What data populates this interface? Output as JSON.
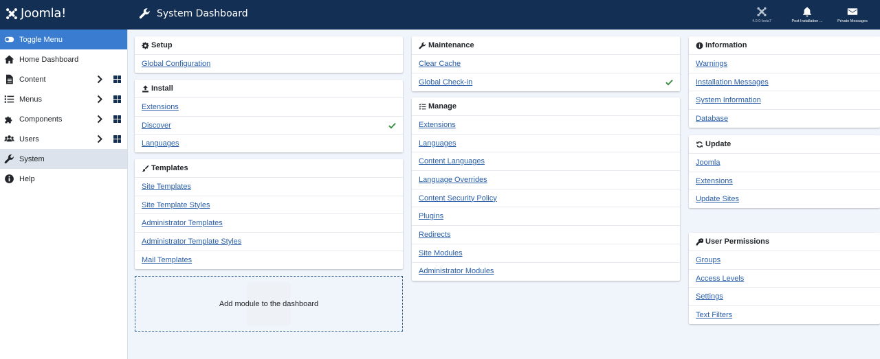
{
  "header": {
    "logo_text": "Joomla!",
    "page_title": "System Dashboard",
    "items": [
      {
        "label": "4.0.0-beta7",
        "icon": "joomla-icon"
      },
      {
        "label": "Post Installation ...",
        "icon": "bell-icon"
      },
      {
        "label": "Private Messages",
        "icon": "envelope-icon"
      }
    ]
  },
  "sidebar": {
    "items": [
      {
        "label": "Toggle Menu",
        "icon": "toggle-icon"
      },
      {
        "label": "Home Dashboard",
        "icon": "home-icon"
      },
      {
        "label": "Content",
        "icon": "file-icon"
      },
      {
        "label": "Menus",
        "icon": "list-icon"
      },
      {
        "label": "Components",
        "icon": "puzzle-icon"
      },
      {
        "label": "Users",
        "icon": "users-icon"
      },
      {
        "label": "System",
        "icon": "wrench-icon"
      },
      {
        "label": "Help",
        "icon": "info-icon"
      }
    ]
  },
  "cards": {
    "setup": {
      "title": "Setup",
      "icon": "cog-icon",
      "links": [
        "Global Configuration"
      ]
    },
    "install": {
      "title": "Install",
      "icon": "upload-icon",
      "links": [
        "Extensions",
        "Discover",
        "Languages"
      ]
    },
    "templates": {
      "title": "Templates",
      "icon": "brush-icon",
      "links": [
        "Site Templates",
        "Site Template Styles",
        "Administrator Templates",
        "Administrator Template Styles",
        "Mail Templates"
      ]
    },
    "maintenance": {
      "title": "Maintenance",
      "icon": "wrench-icon",
      "links": [
        "Clear Cache",
        "Global Check-in"
      ]
    },
    "manage": {
      "title": "Manage",
      "icon": "list-check-icon",
      "links": [
        "Extensions",
        "Languages",
        "Content Languages",
        "Language Overrides",
        "Content Security Policy",
        "Plugins",
        "Redirects",
        "Site Modules",
        "Administrator Modules"
      ]
    },
    "information": {
      "title": "Information",
      "icon": "info-icon",
      "links": [
        "Warnings",
        "Installation Messages",
        "System Information",
        "Database"
      ]
    },
    "update": {
      "title": "Update",
      "icon": "sync-icon",
      "links": [
        "Joomla",
        "Extensions",
        "Update Sites"
      ]
    },
    "permissions": {
      "title": "User Permissions",
      "icon": "key-icon",
      "links": [
        "Groups",
        "Access Levels",
        "Settings",
        "Text Filters"
      ]
    }
  },
  "add_module": {
    "label": "Add module to the dashboard"
  },
  "colors": {
    "header": "#132f53",
    "accent": "#3a7cd0",
    "link": "#2a5fa8",
    "check": "#2f8a3a"
  }
}
